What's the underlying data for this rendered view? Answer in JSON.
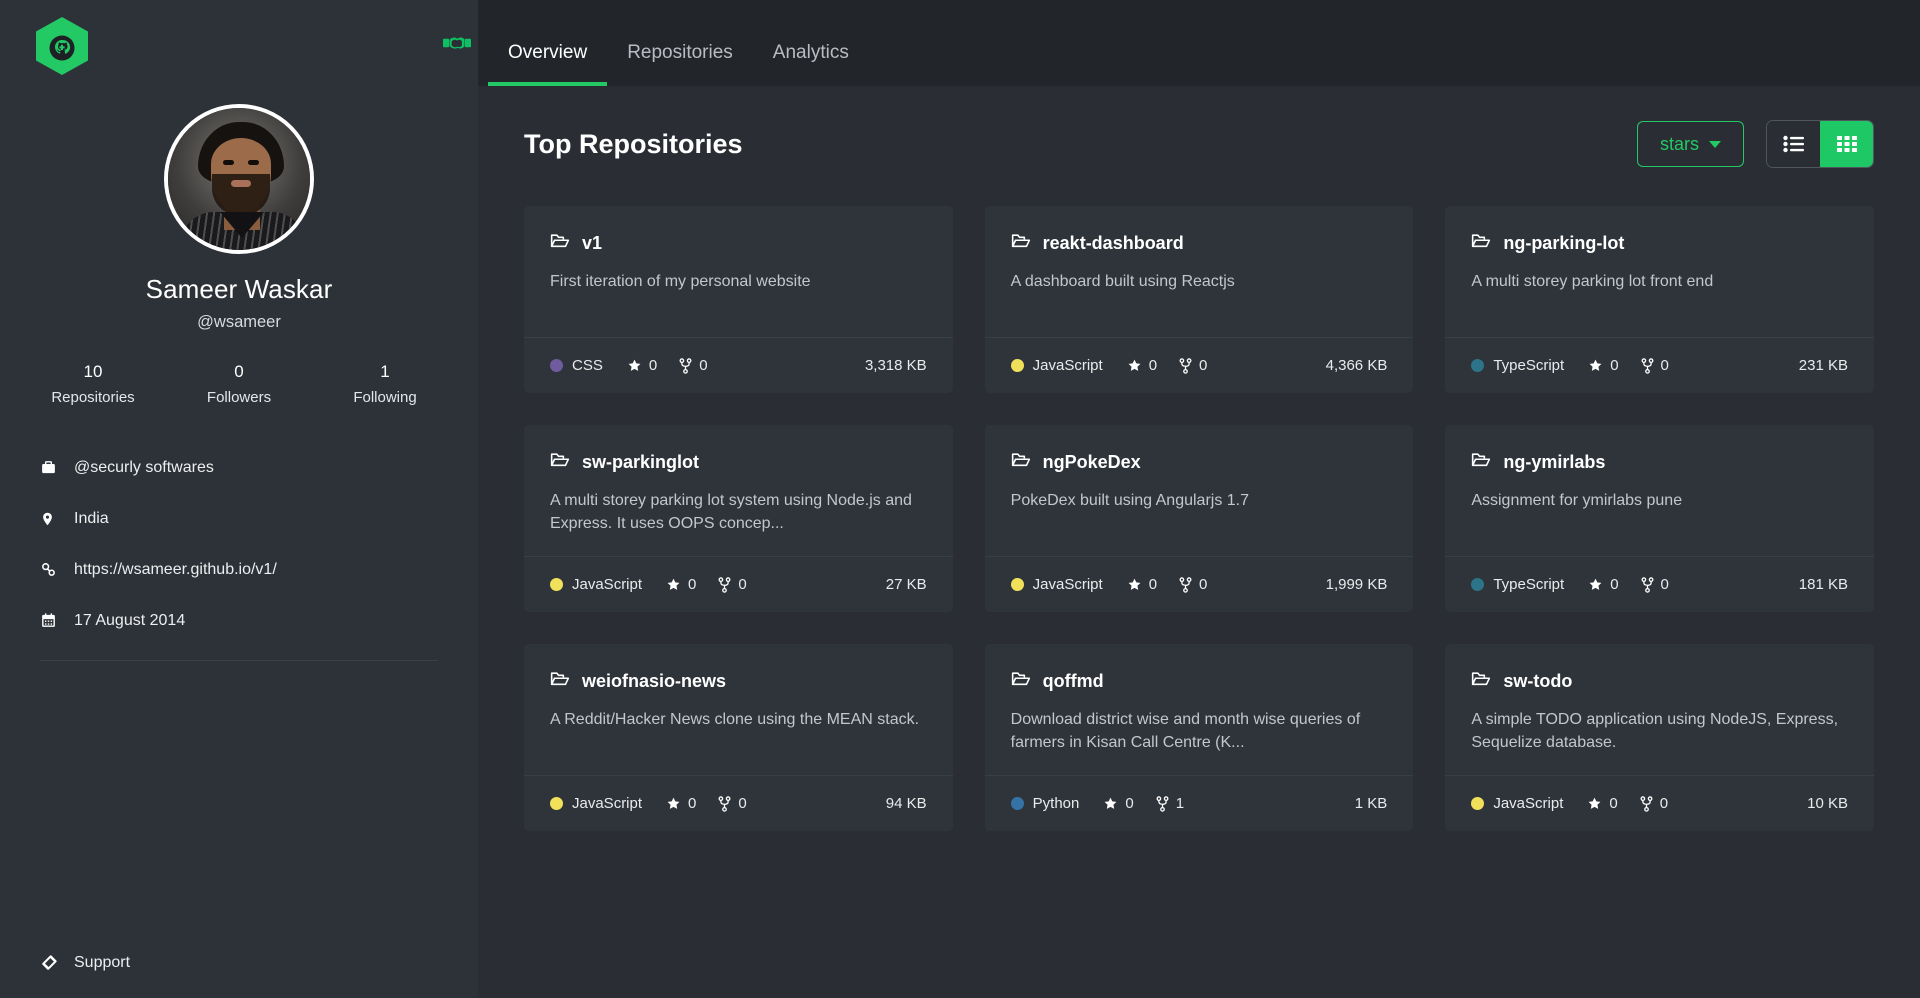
{
  "brand": {
    "logo_icon": "github-hexagon-logo",
    "handshake_icon": "handshake-icon"
  },
  "profile": {
    "name": "Sameer Waskar",
    "handle": "@wsameer",
    "avatar_alt": "avatar",
    "stats": [
      {
        "value": "10",
        "label": "Repositories"
      },
      {
        "value": "0",
        "label": "Followers"
      },
      {
        "value": "1",
        "label": "Following"
      }
    ],
    "meta": [
      {
        "icon": "briefcase-icon",
        "text": "@securly softwares"
      },
      {
        "icon": "location-pin-icon",
        "text": "India"
      },
      {
        "icon": "link-icon",
        "text": "https://wsameer.github.io/v1/"
      },
      {
        "icon": "calendar-icon",
        "text": "17 August 2014"
      }
    ],
    "support_label": "Support",
    "support_icon": "ticket-icon"
  },
  "nav": {
    "tabs": [
      {
        "label": "Overview",
        "active": true
      },
      {
        "label": "Repositories",
        "active": false
      },
      {
        "label": "Analytics",
        "active": false
      }
    ]
  },
  "main": {
    "title": "Top Repositories",
    "sort_label": "stars",
    "sort_icon": "chevron-down-icon",
    "view_list_icon": "list-view-icon",
    "view_grid_icon": "grid-view-icon",
    "active_view": "grid"
  },
  "colors": {
    "accent": "#22c965",
    "sidebar_bg": "#2d3238",
    "content_bg": "#2a2e34",
    "card_bg": "#2f343a",
    "page_bg": "#22262b",
    "lang_css": "#6f5b9e",
    "lang_javascript": "#f1e05a",
    "lang_typescript": "#2b7489",
    "lang_python": "#3572a5"
  },
  "repositories": [
    {
      "name": "v1",
      "description": "First iteration of my personal website",
      "language": "CSS",
      "language_color": "#6f5b9e",
      "stars": "0",
      "forks": "0",
      "size": "3,318 KB"
    },
    {
      "name": "reakt-dashboard",
      "description": "A dashboard built using Reactjs",
      "language": "JavaScript",
      "language_color": "#f1e05a",
      "stars": "0",
      "forks": "0",
      "size": "4,366 KB"
    },
    {
      "name": "ng-parking-lot",
      "description": "A multi storey parking lot front end",
      "language": "TypeScript",
      "language_color": "#2b7489",
      "stars": "0",
      "forks": "0",
      "size": "231 KB"
    },
    {
      "name": "sw-parkinglot",
      "description": "A multi storey parking lot system using Node.js and Express. It uses OOPS concep...",
      "language": "JavaScript",
      "language_color": "#f1e05a",
      "stars": "0",
      "forks": "0",
      "size": "27 KB"
    },
    {
      "name": "ngPokeDex",
      "description": "PokeDex built using Angularjs 1.7",
      "language": "JavaScript",
      "language_color": "#f1e05a",
      "stars": "0",
      "forks": "0",
      "size": "1,999 KB"
    },
    {
      "name": "ng-ymirlabs",
      "description": "Assignment for ymirlabs pune",
      "language": "TypeScript",
      "language_color": "#2b7489",
      "stars": "0",
      "forks": "0",
      "size": "181 KB"
    },
    {
      "name": "weiofnasio-news",
      "description": "A Reddit/Hacker News clone using the MEAN stack.",
      "language": "JavaScript",
      "language_color": "#f1e05a",
      "stars": "0",
      "forks": "0",
      "size": "94 KB"
    },
    {
      "name": "qoffmd",
      "description": "Download district wise and month wise queries of farmers in Kisan Call Centre (K...",
      "language": "Python",
      "language_color": "#3572a5",
      "stars": "0",
      "forks": "1",
      "size": "1 KB"
    },
    {
      "name": "sw-todo",
      "description": "A simple TODO application using NodeJS, Express, Sequelize database.",
      "language": "JavaScript",
      "language_color": "#f1e05a",
      "stars": "0",
      "forks": "0",
      "size": "10 KB"
    }
  ]
}
